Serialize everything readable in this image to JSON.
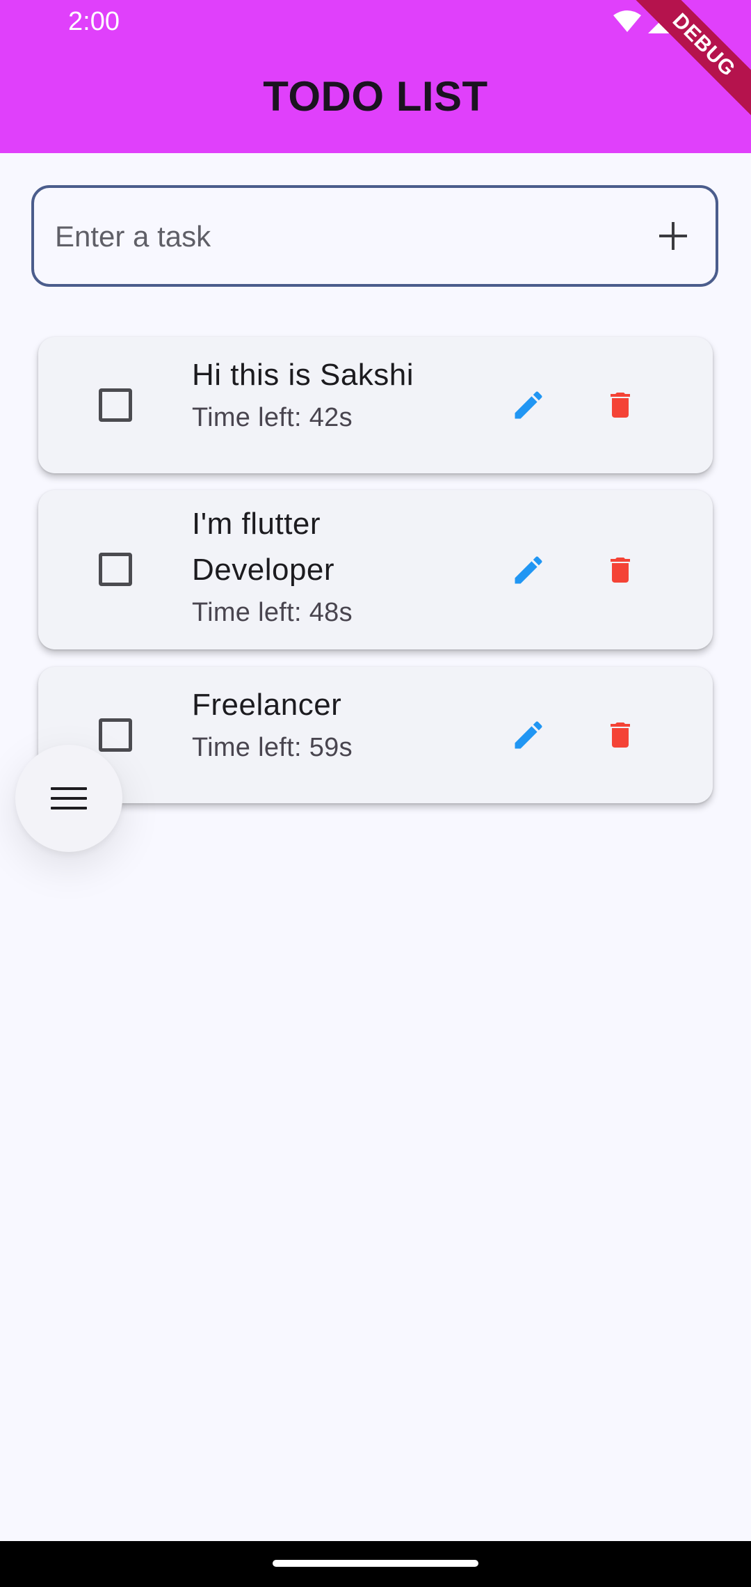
{
  "status_bar": {
    "time": "2:00"
  },
  "app_bar": {
    "title": "TODO LIST",
    "debug_label": "DEBUG",
    "background_color": "#e040fb"
  },
  "input": {
    "placeholder": "Enter a task",
    "add_icon": "plus-icon"
  },
  "tasks": [
    {
      "title": "Hi this is Sakshi",
      "subtitle": "Time left: 42s",
      "checked": false
    },
    {
      "title": "I'm flutter Developer",
      "subtitle": "Time left: 48s",
      "checked": false
    },
    {
      "title": "Freelancer",
      "subtitle": "Time left: 59s",
      "checked": false
    }
  ],
  "icons": {
    "edit": "pencil-icon",
    "delete": "trash-icon",
    "menu": "menu-icon"
  },
  "colors": {
    "edit_icon": "#2196f3",
    "delete_icon": "#f44336",
    "input_border": "#4b5d8c"
  }
}
